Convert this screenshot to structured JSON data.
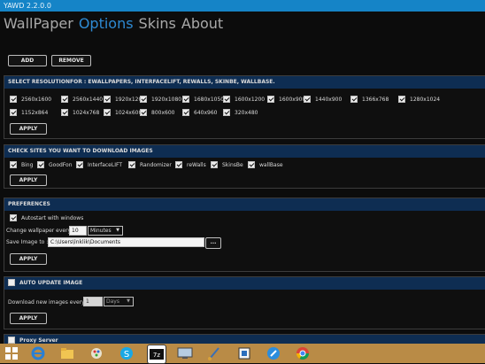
{
  "window": {
    "title": "YAWD 2.2.0.0"
  },
  "nav": {
    "tabs": [
      "WallPaper",
      "Options",
      "Skins",
      "About"
    ],
    "active": "Options"
  },
  "top_buttons": {
    "add": "ADD",
    "remove": "REMOVE"
  },
  "resolution": {
    "heading": "SELECT RESOLUTIONFOR : EWALLPAPERS, INTERFACELIFT, REWALLS, SKINBE, WALLBASE.",
    "items": [
      "2560x1600",
      "2560x1440",
      "1920x1200",
      "1920x1080",
      "1680x1050",
      "1600x1200",
      "1600x900",
      "1440x900",
      "1366x768",
      "1280x1024",
      "1152x864",
      "1024x768",
      "1024x600",
      "800x600",
      "640x960",
      "320x480"
    ],
    "apply": "APPLY"
  },
  "sites": {
    "heading": "CHECK SITES YOU WANT TO DOWNLOAD IMAGES",
    "items": [
      "Bing",
      "GoodFon",
      "InterfaceLIFT",
      "Randomizer",
      "reWalls",
      "SkinsBe",
      "wallBase"
    ],
    "apply": "APPLY"
  },
  "preferences": {
    "heading": "PREFERENCES",
    "autostart": "Autostart with windows",
    "change_label": "Change wallpaper every",
    "change_value": "10",
    "change_unit": "Minutes",
    "save_label": "Save Image to :",
    "save_path": "C:\\Users\\lnklik\\Documents",
    "browse": "...",
    "apply": "APPLY"
  },
  "auto_update": {
    "heading": "AUTO UPDATE IMAGE",
    "download_label": "Download new images every",
    "download_value": "1",
    "download_unit": "Days",
    "apply": "APPLY"
  },
  "proxy": {
    "heading": "Proxy Server"
  },
  "taskbar": {
    "icons": [
      "windows-start-icon",
      "internet-explorer-icon",
      "file-explorer-icon",
      "paint-icon",
      "skype-icon",
      "maps-icon",
      "7zip-icon",
      "remote-desktop-icon",
      "paint-brush-icon",
      "installer-icon",
      "feather-icon",
      "chrome-icon"
    ]
  },
  "colors": {
    "accent": "#1584c7",
    "nav_active": "#2e8ad3",
    "section_head": "#0e2d52",
    "taskbar": "#b98b46"
  }
}
